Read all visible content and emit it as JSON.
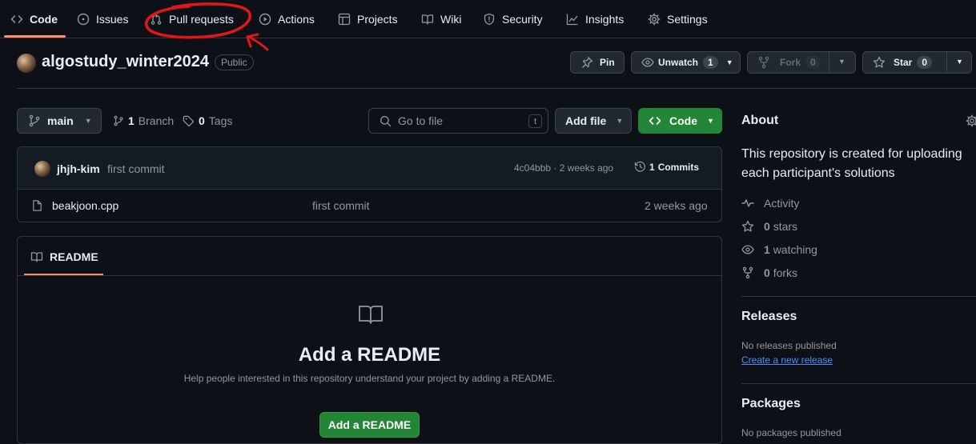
{
  "nav": {
    "tabs": [
      {
        "label": "Code"
      },
      {
        "label": "Issues"
      },
      {
        "label": "Pull requests"
      },
      {
        "label": "Actions"
      },
      {
        "label": "Projects"
      },
      {
        "label": "Wiki"
      },
      {
        "label": "Security"
      },
      {
        "label": "Insights"
      },
      {
        "label": "Settings"
      }
    ],
    "active": "Code"
  },
  "repo": {
    "name": "algostudy_winter2024",
    "visibility": "Public",
    "pin_label": "Pin",
    "unwatch_label": "Unwatch",
    "watch_count": "1",
    "fork_label": "Fork",
    "fork_count": "0",
    "star_label": "Star",
    "star_count": "0"
  },
  "file_nav": {
    "branch": "main",
    "branch_count": "1",
    "branch_label": "Branch",
    "tag_count": "0",
    "tag_label": "Tags",
    "search_placeholder": "Go to file",
    "search_shortcut": "t",
    "add_file_label": "Add file",
    "code_label": "Code"
  },
  "commit": {
    "author": "jhjh-kim",
    "message": "first commit",
    "hash_time": "4c04bbb · 2 weeks ago",
    "commits_count": "1",
    "commits_label": "Commits"
  },
  "files": [
    {
      "name": "beakjoon.cpp",
      "message": "first commit",
      "time": "2 weeks ago"
    }
  ],
  "readme": {
    "tab_label": "README",
    "heading": "Add a README",
    "description": "Help people interested in this repository understand your project by adding a README.",
    "button_label": "Add a README"
  },
  "about": {
    "heading": "About",
    "description_line1": "This repository is created for uploading",
    "description_line2": "each participant's solutions",
    "activity": "Activity",
    "stars_count": "0",
    "stars_label": "stars",
    "watching_count": "1",
    "watching_label": "watching",
    "forks_count": "0",
    "forks_label": "forks"
  },
  "releases": {
    "heading": "Releases",
    "empty": "No releases published",
    "create_link": "Create a new release"
  },
  "packages": {
    "heading": "Packages",
    "empty": "No packages published"
  },
  "colors": {
    "background": "#0d1117",
    "accent_underline": "#fd8c73",
    "primary_green": "#238636",
    "link_blue": "#4493f8",
    "annotation_red": "#e0161b"
  }
}
